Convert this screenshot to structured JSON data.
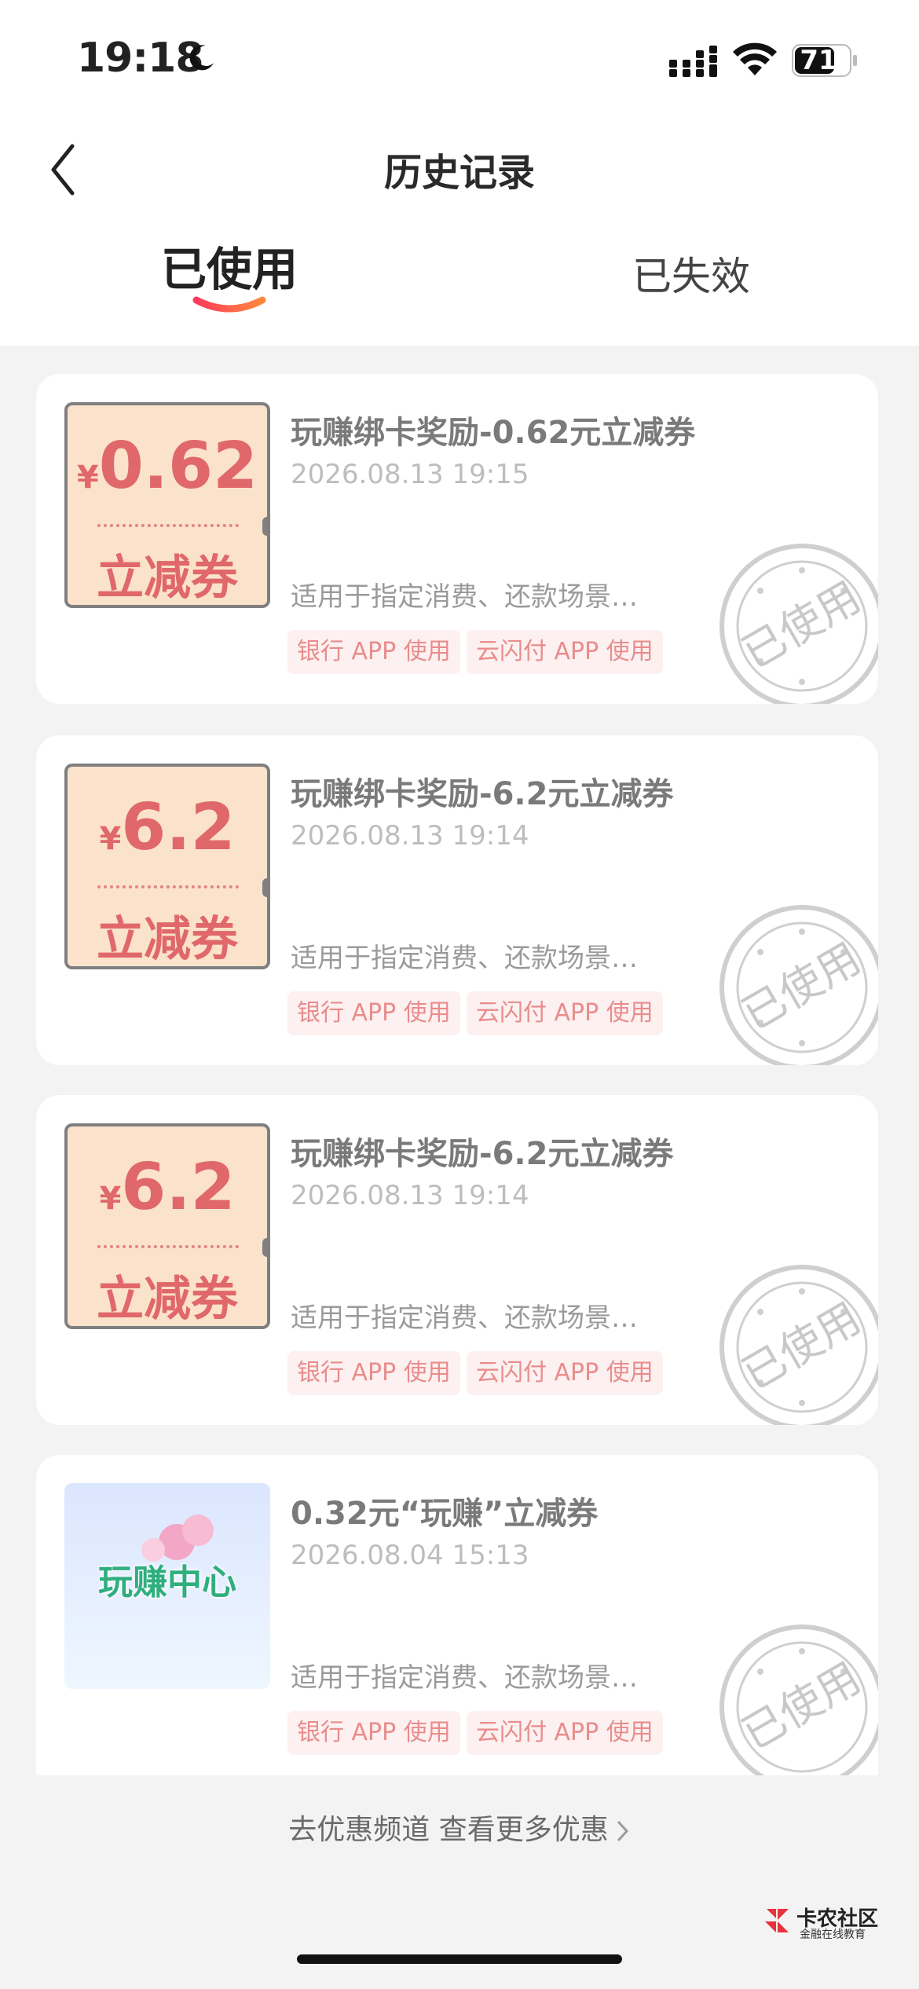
{
  "status": {
    "time": "19:18",
    "battery": "71"
  },
  "nav": {
    "title": "历史记录"
  },
  "tabs": {
    "used": "已使用",
    "expired": "已失效"
  },
  "cards": [
    {
      "thumb_type": "coupon",
      "currency": "¥",
      "amount": "0.62",
      "thumb_label": "立减券",
      "title": "玩赚绑卡奖励-0.62元立减券",
      "date": "2026.08.13 19:15",
      "desc": "适用于指定消费、还款场景…",
      "tags": [
        "银行 APP 使用",
        "云闪付 APP 使用"
      ],
      "stamp": "已使用"
    },
    {
      "thumb_type": "coupon",
      "currency": "¥",
      "amount": "6.2",
      "thumb_label": "立减券",
      "title": "玩赚绑卡奖励-6.2元立减券",
      "date": "2026.08.13 19:14",
      "desc": "适用于指定消费、还款场景…",
      "tags": [
        "银行 APP 使用",
        "云闪付 APP 使用"
      ],
      "stamp": "已使用"
    },
    {
      "thumb_type": "coupon",
      "currency": "¥",
      "amount": "6.2",
      "thumb_label": "立减券",
      "title": "玩赚绑卡奖励-6.2元立减券",
      "date": "2026.08.13 19:14",
      "desc": "适用于指定消费、还款场景…",
      "tags": [
        "银行 APP 使用",
        "云闪付 APP 使用"
      ],
      "stamp": "已使用"
    },
    {
      "thumb_type": "center",
      "thumb_label": "玩赚中心",
      "title": "0.32元“玩赚”立减券",
      "date": "2026.08.04 15:13",
      "desc": "适用于指定消费、还款场景…",
      "tags": [
        "银行 APP 使用",
        "云闪付 APP 使用"
      ],
      "stamp": "已使用"
    }
  ],
  "footer": {
    "link": "去优惠频道 查看更多优惠"
  },
  "watermark": {
    "title": "卡农社区",
    "subtitle": "金融在线教育"
  },
  "colors": {
    "accent": "#e0686a",
    "tag_bg": "#fdf0f0",
    "page_bg": "#f3f3f3"
  },
  "icons": [
    "moon-icon",
    "signal-icon",
    "wifi-icon",
    "battery-icon",
    "back-arrow-icon",
    "chevron-right-icon",
    "used-stamp-icon"
  ]
}
